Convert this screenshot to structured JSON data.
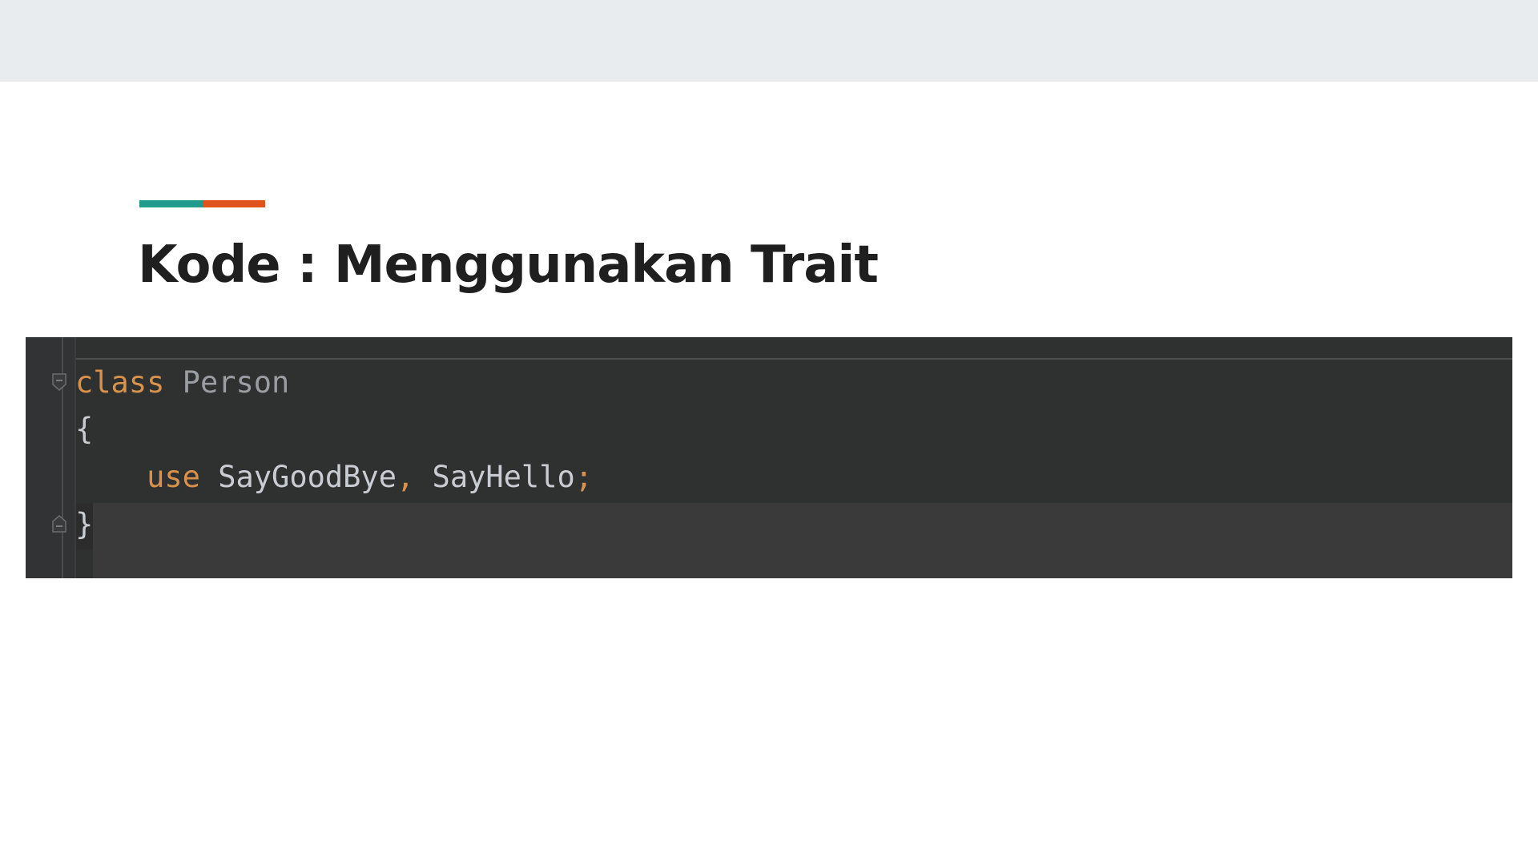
{
  "slide": {
    "title": "Kode : Menggunakan Trait",
    "accent_colors": [
      "#1f9b8c",
      "#e0531b"
    ]
  },
  "code": {
    "lines": [
      {
        "keyword": "class",
        "space": " ",
        "name": "Person"
      },
      {
        "text": "{"
      },
      {
        "indent": "    ",
        "keyword": "use",
        "space": " ",
        "ident1": "SayGoodBye",
        "sep": ",",
        "space2": " ",
        "ident2": "SayHello",
        "term": ";"
      },
      {
        "text": "}"
      }
    ],
    "colors": {
      "keyword": "#d9924b",
      "identifier": "#c9cdd3",
      "class_name": "#9a9ea3",
      "background": "#2f3030"
    }
  }
}
